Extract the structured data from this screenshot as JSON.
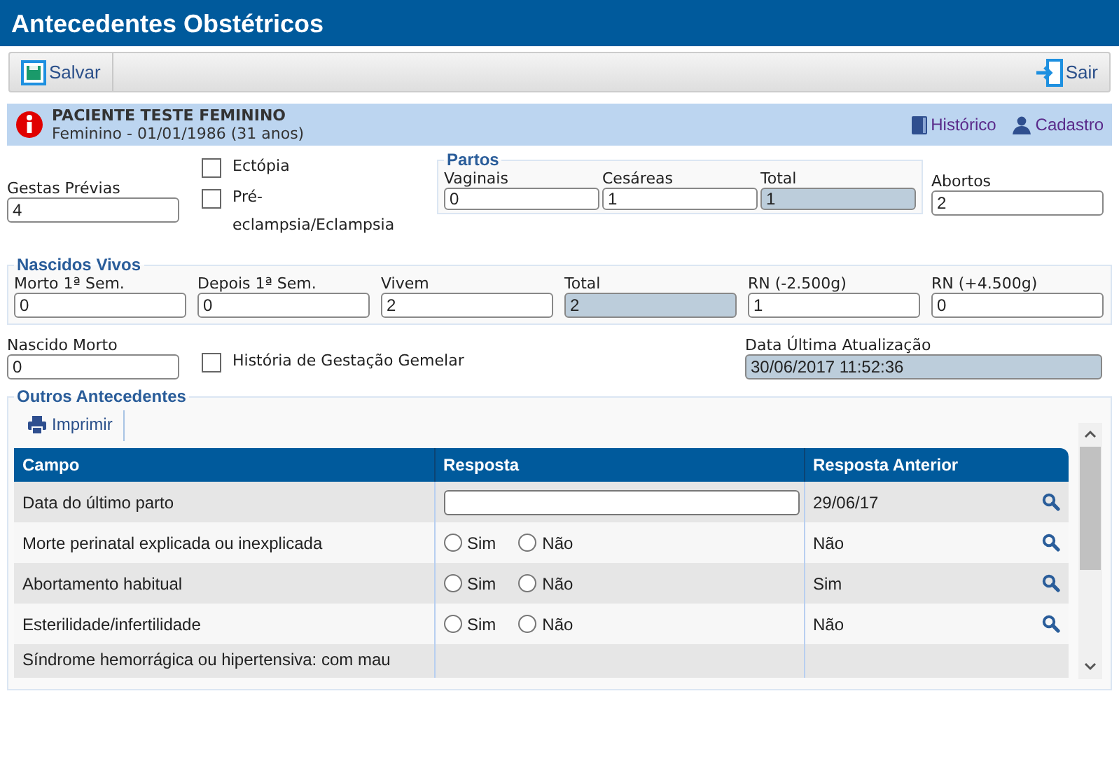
{
  "window": {
    "title": "Antecedentes Obstétricos"
  },
  "toolbar": {
    "save": "Salvar",
    "exit": "Sair"
  },
  "patient": {
    "name": "PACIENTE TESTE FEMININO",
    "details": "Feminino - 01/01/1986 (31 anos)",
    "links": [
      "Histórico",
      "Cadastro"
    ]
  },
  "gestas_previas": {
    "label": "Gestas Prévias",
    "value": "4"
  },
  "checks": [
    {
      "label": "Ectópia",
      "checked": false
    },
    {
      "label": "Pré-eclampsia/Eclampsia",
      "checked": false
    }
  ],
  "partos": {
    "title": "Partos",
    "fields": [
      {
        "label": "Vaginais",
        "value": "0",
        "readonly": false
      },
      {
        "label": "Cesáreas",
        "value": "1",
        "readonly": false
      },
      {
        "label": "Total",
        "value": "1",
        "readonly": true
      }
    ]
  },
  "abortos": {
    "label": "Abortos",
    "value": "2"
  },
  "nascidos_vivos": {
    "title": "Nascidos Vivos",
    "fields": [
      {
        "label": "Morto 1ª Sem.",
        "value": "0",
        "readonly": false
      },
      {
        "label": "Depois 1ª Sem.",
        "value": "0",
        "readonly": false
      },
      {
        "label": "Vivem",
        "value": "2",
        "readonly": false
      },
      {
        "label": "Total",
        "value": "2",
        "readonly": true
      },
      {
        "label": "RN (-2.500g)",
        "value": "1",
        "readonly": false
      },
      {
        "label": "RN (+4.500g)",
        "value": "0",
        "readonly": false
      }
    ]
  },
  "nascido_morto": {
    "label": "Nascido Morto",
    "value": "0"
  },
  "gemelar": {
    "label": "História de Gestação Gemelar",
    "checked": false
  },
  "ultima_atualizacao": {
    "label": "Data Última Atualização",
    "value": "30/06/2017 11:52:36"
  },
  "outros": {
    "title": "Outros Antecedentes",
    "print": "Imprimir",
    "table": {
      "columns": [
        "Campo",
        "Resposta",
        "Resposta Anterior"
      ],
      "rows": [
        {
          "kind": "date",
          "campo": "Data do último parto",
          "anterior": "29/06/17"
        },
        {
          "kind": "radio",
          "campo": "Morte perinatal explicada ou inexplicada",
          "options": [
            {
              "label": "Sim",
              "selected": false
            },
            {
              "label": "Não",
              "selected": false
            }
          ],
          "anterior": "Não"
        },
        {
          "kind": "radio",
          "campo": "Abortamento habitual",
          "options": [
            {
              "label": "Sim",
              "selected": false
            },
            {
              "label": "Não",
              "selected": false
            }
          ],
          "anterior": "Sim"
        },
        {
          "kind": "radio",
          "campo": "Esterilidade/infertilidade",
          "options": [
            {
              "label": "Sim",
              "selected": false
            },
            {
              "label": "Não",
              "selected": false
            }
          ],
          "anterior": "Não"
        },
        {
          "kind": "partial",
          "campo": "Síndrome hemorrágica ou hipertensiva: com mau"
        }
      ]
    }
  }
}
